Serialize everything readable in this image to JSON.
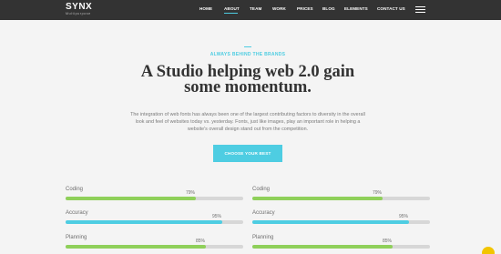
{
  "header": {
    "logo_text": "SYNX",
    "logo_tagline": "Multipurpose",
    "nav": [
      {
        "label": "HOME",
        "active": false
      },
      {
        "label": "ABOUT",
        "active": true
      },
      {
        "label": "TEAM",
        "active": false
      },
      {
        "label": "WORK",
        "active": false
      },
      {
        "label": "PRICES",
        "active": false
      },
      {
        "label": "BLOG",
        "active": false
      },
      {
        "label": "ELEMENTS",
        "active": false
      },
      {
        "label": "CONTACT US",
        "active": false
      }
    ],
    "menu_icon": "hamburger-menu-icon"
  },
  "hero": {
    "eyebrow": "ALWAYS BEHIND THE BRANDS",
    "headline_line1": "A Studio helping web 2.0 gain",
    "headline_line2": "some momentum.",
    "lead": "The integration of web fonts has always been one of the largest contributing factors to diversity in the overall look and feel of websites today vs. yesterday. Fonts, just like images, play an important role in helping a website's overall design stand out from the competition.",
    "cta_label": "CHOOSE YOUR BEST"
  },
  "skills": {
    "left": [
      {
        "label": "Coding",
        "percent_label": "79%",
        "value": 79,
        "color": "#8fd05a"
      },
      {
        "label": "Accuracy",
        "percent_label": "95%",
        "value": 95,
        "color": "#4ecde2"
      },
      {
        "label": "Planning",
        "percent_label": "85%",
        "value": 85,
        "color": "#8fd05a"
      }
    ],
    "right": [
      {
        "label": "Coding",
        "percent_label": "79%",
        "value": 79,
        "color": "#8fd05a"
      },
      {
        "label": "Accuracy",
        "percent_label": "95%",
        "value": 95,
        "color": "#4ecde2"
      },
      {
        "label": "Planning",
        "percent_label": "85%",
        "value": 85,
        "color": "#8fd05a"
      }
    ]
  },
  "colors": {
    "accent": "#4ecde2",
    "header_bg": "#333333",
    "bar_green": "#8fd05a",
    "chat_button": "#f2c500"
  }
}
